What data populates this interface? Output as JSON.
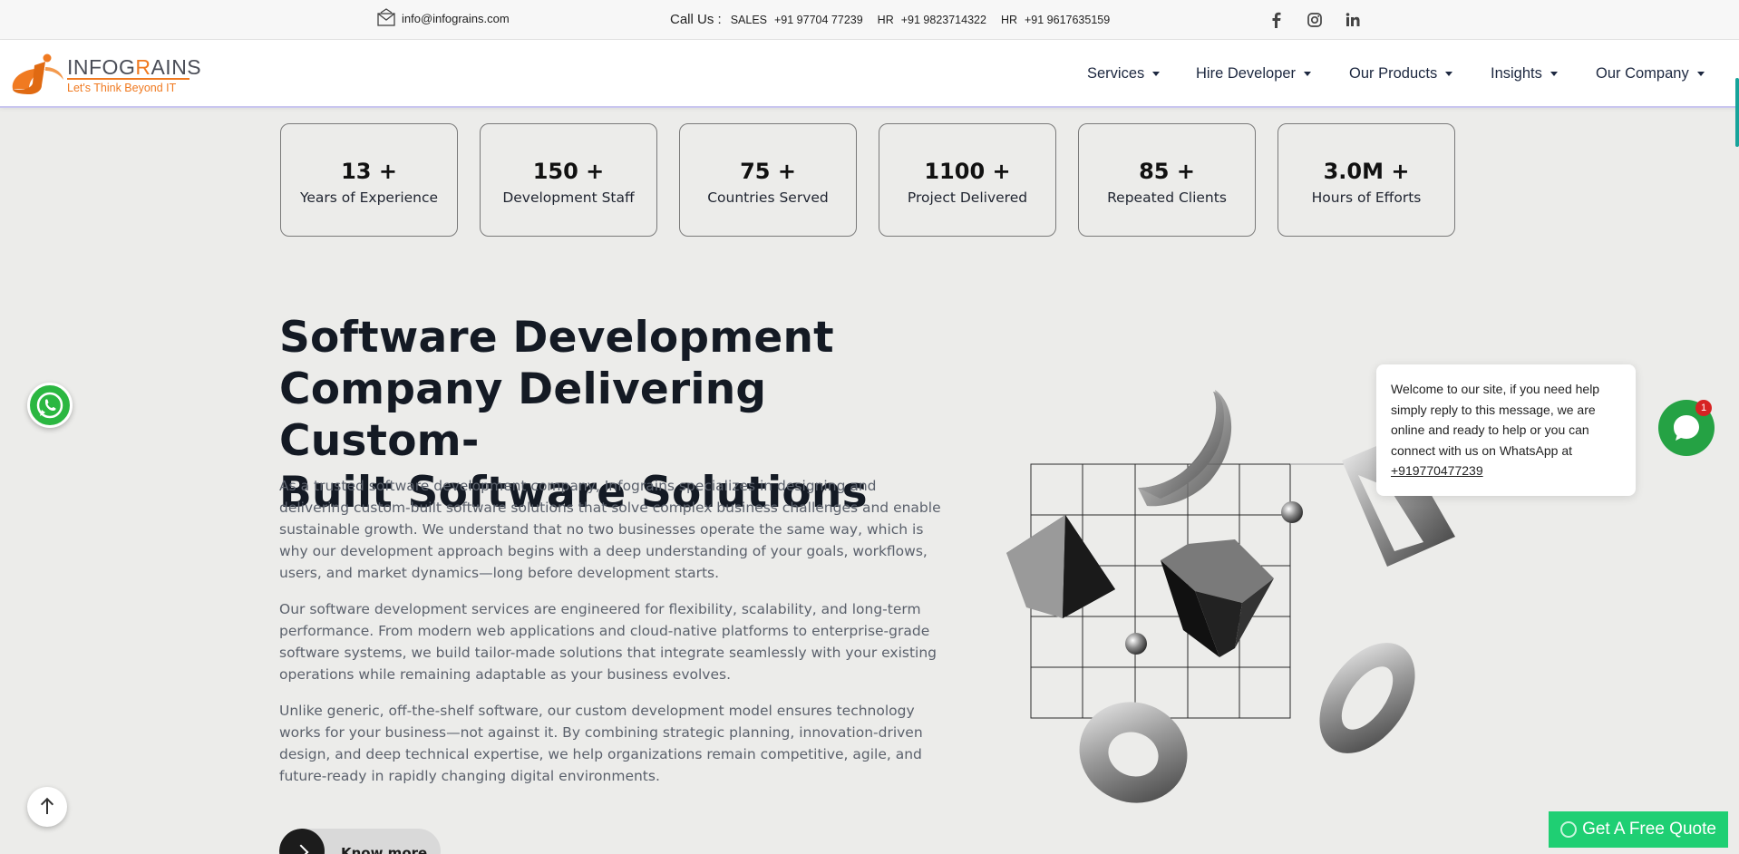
{
  "topbar": {
    "email": "info@infograins.com",
    "call_label": "Call Us :",
    "contacts": [
      {
        "key": "SALES",
        "number": "+91 97704 77239"
      },
      {
        "key": "HR",
        "number": "+91 9823714322"
      },
      {
        "key": "HR",
        "number": "+91 9617635159"
      }
    ],
    "social_icons": [
      "facebook-icon",
      "instagram-icon",
      "linkedin-icon"
    ]
  },
  "header": {
    "logo": {
      "name_part1": "INFOG",
      "name_accent": "R",
      "name_part2": "AINS",
      "tagline": "Let's Think Beyond IT"
    },
    "nav": [
      "Services",
      "Hire Developer",
      "Our Products",
      "Insights",
      "Our Company"
    ]
  },
  "stats": [
    {
      "value": "13 +",
      "label": "Years of Experience"
    },
    {
      "value": "150 +",
      "label": "Development Staff"
    },
    {
      "value": "75 +",
      "label": "Countries Served"
    },
    {
      "value": "1100 +",
      "label": "Project Delivered"
    },
    {
      "value": "85 +",
      "label": "Repeated Clients"
    },
    {
      "value": "3.0M +",
      "label": "Hours of Efforts"
    }
  ],
  "hero": {
    "title_lines": [
      "Software Development",
      "Company Delivering Custom-",
      "Built Software Solutions"
    ],
    "paragraphs": [
      "As a trusted software development company, Infograins specializes in designing and delivering custom-built software solutions that solve complex business challenges and enable sustainable growth. We understand that no two businesses operate the same way, which is why our development approach begins with a deep understanding of your goals, workflows, users, and market dynamics—long before development starts.",
      "Our software development services are engineered for flexibility, scalability, and long-term performance. From modern web applications and cloud-native platforms to enterprise-grade software systems, we build tailor-made solutions that integrate seamlessly with your existing operations while remaining adaptable as your business evolves.",
      "Unlike generic, off-the-shelf software, our custom development model ensures technology works for your business—not against it. By combining strategic planning, innovation-driven design, and deep technical expertise, we help organizations remain competitive, agile, and future-ready in rapidly changing digital environments."
    ],
    "cta": "Know more"
  },
  "chat": {
    "message": "Welcome to our site, if you need help simply reply to this message, we are online and ready to help or you can connect with us on WhatsApp at",
    "phone": "+919770477239",
    "badge": "1"
  },
  "quote_button": "Get A Free Quote",
  "colors": {
    "brand_orange": "#f07a21",
    "whatsapp_green": "#25a244",
    "quote_green": "#1fcf73",
    "nav_text": "#1d2840"
  }
}
